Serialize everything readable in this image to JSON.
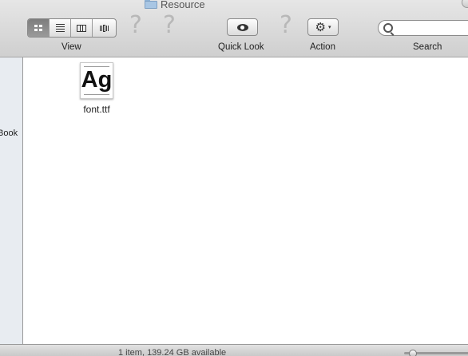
{
  "window": {
    "title": "Resource"
  },
  "toolbar": {
    "view_label": "View",
    "quicklook_label": "Quick Look",
    "action_label": "Action",
    "search_label": "Search",
    "search_placeholder": "",
    "unknown_glyph": "?",
    "gear_glyph": "⚙",
    "caret_glyph": "▾",
    "view_modes": [
      "icon-view",
      "list-view",
      "column-view",
      "coverflow-view"
    ],
    "active_view": "icon-view"
  },
  "sidebar": {
    "items": [
      {
        "label": "Book"
      }
    ]
  },
  "files": [
    {
      "name": "font.ttf",
      "icon_text": "Ag"
    }
  ],
  "status": {
    "text": "1 item, 139.24 GB available"
  }
}
